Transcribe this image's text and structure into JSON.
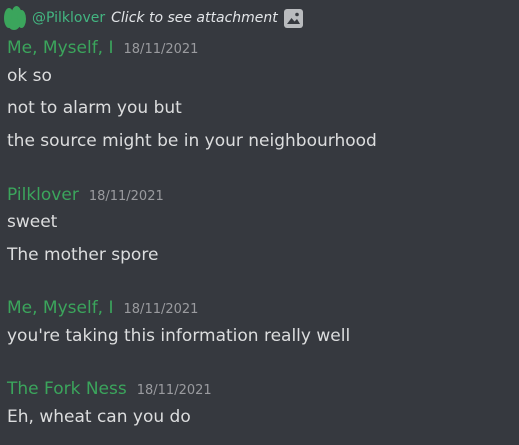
{
  "reply": {
    "username": "@Pilklover",
    "attachment_text": "Click to see attachment"
  },
  "messages": [
    {
      "author": "Me, Myself, I",
      "timestamp": "18/11/2021",
      "lines": [
        "ok so",
        "not to alarm you but",
        "the source might be in your neighbourhood"
      ]
    },
    {
      "author": "Pilklover",
      "timestamp": "18/11/2021",
      "lines": [
        "sweet",
        "The mother spore"
      ]
    },
    {
      "author": "Me, Myself, I",
      "timestamp": "18/11/2021",
      "lines": [
        "you're taking this information really well"
      ]
    },
    {
      "author": "The Fork Ness",
      "timestamp": "18/11/2021",
      "lines": [
        "Eh, wheat can you do"
      ]
    }
  ],
  "colors": {
    "background": "#36393f",
    "author": "#3ba55c",
    "text": "#dcddde",
    "timestamp": "#9a9b9f"
  }
}
